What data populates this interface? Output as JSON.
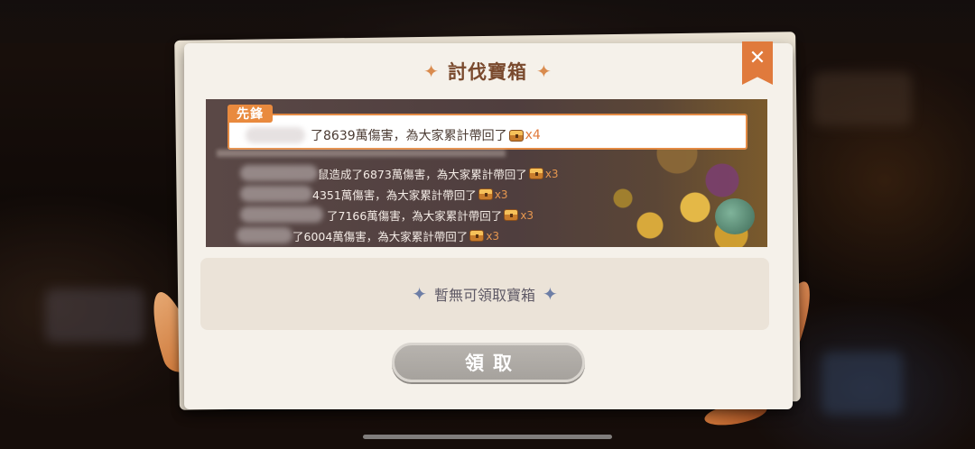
{
  "dialog": {
    "title": "討伐寶箱",
    "close_label": "✕",
    "title_star": "✦"
  },
  "log": {
    "vanguard_label": "先鋒",
    "highlight": {
      "text": "了8639萬傷害，為大家累計帶回了",
      "multiplier": "x4"
    },
    "entries": [
      {
        "text": "鼠造成了6873萬傷害，為大家累計帶回了",
        "multiplier": "x3"
      },
      {
        "text": "4351萬傷害，為大家累計帶回了",
        "multiplier": "x3"
      },
      {
        "text": "了7166萬傷害，為大家累計帶回了",
        "multiplier": "x3"
      },
      {
        "text": "了6004萬傷害，為大家累計帶回了",
        "multiplier": "x3"
      }
    ]
  },
  "empty_state": {
    "text": "暫無可領取寶箱",
    "ornament": "✦"
  },
  "claim_button": {
    "label": "領取"
  },
  "colors": {
    "accent": "#e07a3c",
    "title": "#7a4a2e",
    "button_disabled": "#b0aca7"
  }
}
